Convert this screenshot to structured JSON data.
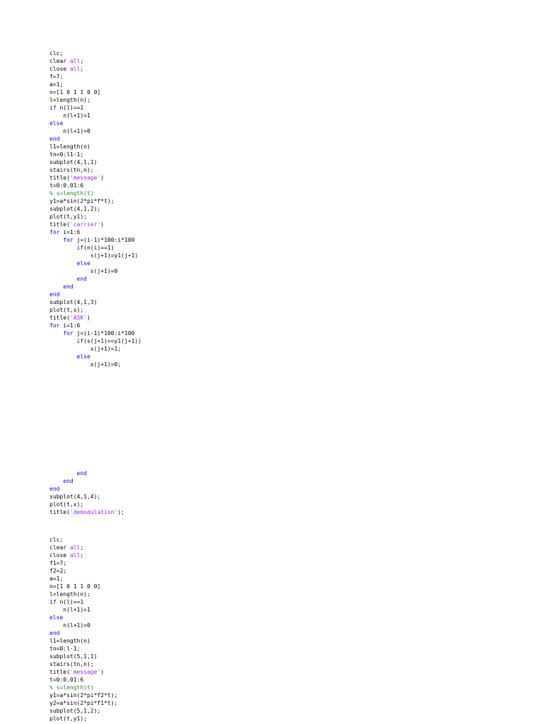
{
  "colors": {
    "plain": "#000000",
    "keyword": "#0000ff",
    "string": "#a020f0",
    "comment": "#228b22"
  },
  "document": {
    "blocks": [
      {
        "name": "ask-code-part-1",
        "lines": [
          [
            {
              "text": "clc;",
              "t": "plain"
            }
          ],
          [
            {
              "text": "clear ",
              "t": "plain"
            },
            {
              "text": "all",
              "t": "string"
            },
            {
              "text": ";",
              "t": "plain"
            }
          ],
          [
            {
              "text": "close ",
              "t": "plain"
            },
            {
              "text": "all",
              "t": "string"
            },
            {
              "text": ";",
              "t": "plain"
            }
          ],
          [
            {
              "text": "f=7;",
              "t": "plain"
            }
          ],
          [
            {
              "text": "a=1;",
              "t": "plain"
            }
          ],
          [
            {
              "text": "n=[1 0 1 1 0 0]",
              "t": "plain"
            }
          ],
          [
            {
              "text": "l=length(n);",
              "t": "plain"
            }
          ],
          [
            {
              "text": "if",
              "t": "keyword"
            },
            {
              "text": " n(l)==1",
              "t": "plain"
            }
          ],
          [
            {
              "text": "    n(l+1)=1",
              "t": "plain"
            }
          ],
          [
            {
              "text": "else",
              "t": "keyword"
            }
          ],
          [
            {
              "text": "    n(l+1)=0",
              "t": "plain"
            }
          ],
          [
            {
              "text": "end",
              "t": "keyword"
            }
          ],
          [
            {
              "text": "l1=length(n)",
              "t": "plain"
            }
          ],
          [
            {
              "text": "tn=0:l1-1;",
              "t": "plain"
            }
          ],
          [
            {
              "text": "subplot(4,1,1)",
              "t": "plain"
            }
          ],
          [
            {
              "text": "stairs(tn,n);",
              "t": "plain"
            }
          ],
          [
            {
              "text": "title(",
              "t": "plain"
            },
            {
              "text": "'message'",
              "t": "string"
            },
            {
              "text": ")",
              "t": "plain"
            }
          ],
          [
            {
              "text": "t=0:0.01:6",
              "t": "plain"
            }
          ],
          [
            {
              "text": "% s=length(t)",
              "t": "comment"
            }
          ],
          [
            {
              "text": "y1=a*sin(2*pi*f*t);",
              "t": "plain"
            }
          ],
          [
            {
              "text": "subplot(4,1,2);",
              "t": "plain"
            }
          ],
          [
            {
              "text": "plot(t,y1);",
              "t": "plain"
            }
          ],
          [
            {
              "text": "title(",
              "t": "plain"
            },
            {
              "text": "'carrier'",
              "t": "string"
            },
            {
              "text": ")",
              "t": "plain"
            }
          ],
          [
            {
              "text": "for",
              "t": "keyword"
            },
            {
              "text": " i=1:6",
              "t": "plain"
            }
          ],
          [
            {
              "text": "    ",
              "t": "plain"
            },
            {
              "text": "for",
              "t": "keyword"
            },
            {
              "text": " j=(i-1)*100:i*100",
              "t": "plain"
            }
          ],
          [
            {
              "text": "        ",
              "t": "plain"
            },
            {
              "text": "if",
              "t": "keyword"
            },
            {
              "text": "(n(i)==1)",
              "t": "plain"
            }
          ],
          [
            {
              "text": "            s(j+1)=y1(j+1)",
              "t": "plain"
            }
          ],
          [
            {
              "text": "        ",
              "t": "plain"
            },
            {
              "text": "else",
              "t": "keyword"
            }
          ],
          [
            {
              "text": "            s(j+1)=0",
              "t": "plain"
            }
          ],
          [
            {
              "text": "        ",
              "t": "plain"
            },
            {
              "text": "end",
              "t": "keyword"
            }
          ],
          [
            {
              "text": "    ",
              "t": "plain"
            },
            {
              "text": "end",
              "t": "keyword"
            }
          ],
          [
            {
              "text": "end",
              "t": "keyword"
            }
          ],
          [
            {
              "text": "subplot(4,1,3)",
              "t": "plain"
            }
          ],
          [
            {
              "text": "plot(t,s);",
              "t": "plain"
            }
          ],
          [
            {
              "text": "title(",
              "t": "plain"
            },
            {
              "text": "'ASK'",
              "t": "string"
            },
            {
              "text": ")",
              "t": "plain"
            }
          ],
          [
            {
              "text": "for",
              "t": "keyword"
            },
            {
              "text": " i=1:6",
              "t": "plain"
            }
          ],
          [
            {
              "text": "    ",
              "t": "plain"
            },
            {
              "text": "for",
              "t": "keyword"
            },
            {
              "text": " j=(i-1)*100:i*100",
              "t": "plain"
            }
          ],
          [
            {
              "text": "        ",
              "t": "plain"
            },
            {
              "text": "if",
              "t": "keyword"
            },
            {
              "text": "(s(j+1)==y1(j+1))",
              "t": "plain"
            }
          ],
          [
            {
              "text": "            x(j+1)=1;",
              "t": "plain"
            }
          ],
          [
            {
              "text": "        ",
              "t": "plain"
            },
            {
              "text": "else",
              "t": "keyword"
            }
          ],
          [
            {
              "text": "            x(j+1)=0;",
              "t": "plain"
            }
          ]
        ]
      },
      {
        "name": "ask-code-part-2",
        "lines": [
          [
            {
              "text": "        ",
              "t": "plain"
            },
            {
              "text": "end",
              "t": "keyword"
            }
          ],
          [
            {
              "text": "    ",
              "t": "plain"
            },
            {
              "text": "end",
              "t": "keyword"
            }
          ],
          [
            {
              "text": "end",
              "t": "keyword"
            }
          ],
          [
            {
              "text": "subplot(4,1,4);",
              "t": "plain"
            }
          ],
          [
            {
              "text": "plot(t,x);",
              "t": "plain"
            }
          ],
          [
            {
              "text": "title(",
              "t": "plain"
            },
            {
              "text": "'demodulation'",
              "t": "string"
            },
            {
              "text": ");",
              "t": "plain"
            }
          ]
        ]
      },
      {
        "name": "fsk-code",
        "lines": [
          [
            {
              "text": "clc;",
              "t": "plain"
            }
          ],
          [
            {
              "text": "clear ",
              "t": "plain"
            },
            {
              "text": "all",
              "t": "string"
            },
            {
              "text": ";",
              "t": "plain"
            }
          ],
          [
            {
              "text": "close ",
              "t": "plain"
            },
            {
              "text": "all",
              "t": "string"
            },
            {
              "text": ";",
              "t": "plain"
            }
          ],
          [
            {
              "text": "f1=7;",
              "t": "plain"
            }
          ],
          [
            {
              "text": "f2=2;",
              "t": "plain"
            }
          ],
          [
            {
              "text": "a=1;",
              "t": "plain"
            }
          ],
          [
            {
              "text": "n=[1 0 1 1 0 0]",
              "t": "plain"
            }
          ],
          [
            {
              "text": "l=length(n);",
              "t": "plain"
            }
          ],
          [
            {
              "text": "if",
              "t": "keyword"
            },
            {
              "text": " n(l)==1",
              "t": "plain"
            }
          ],
          [
            {
              "text": "    n(l+1)=1",
              "t": "plain"
            }
          ],
          [
            {
              "text": "else",
              "t": "keyword"
            }
          ],
          [
            {
              "text": "    n(l+1)=0",
              "t": "plain"
            }
          ],
          [
            {
              "text": "end",
              "t": "keyword"
            }
          ],
          [
            {
              "text": "l1=length(n)",
              "t": "plain"
            }
          ],
          [
            {
              "text": "tn=0:l-1;",
              "t": "plain"
            }
          ],
          [
            {
              "text": "subplot(5,1,1)",
              "t": "plain"
            }
          ],
          [
            {
              "text": "stairs(tn,n);",
              "t": "plain"
            }
          ],
          [
            {
              "text": "title(",
              "t": "plain"
            },
            {
              "text": "'message'",
              "t": "string"
            },
            {
              "text": ")",
              "t": "plain"
            }
          ],
          [
            {
              "text": "t=0:0.01:6",
              "t": "plain"
            }
          ],
          [
            {
              "text": "% s=length(t)",
              "t": "comment"
            }
          ],
          [
            {
              "text": "y1=a*sin(2*pi*f2*t);",
              "t": "plain"
            }
          ],
          [
            {
              "text": "y2=a*sin(2*pi*f1*t);",
              "t": "plain"
            }
          ],
          [
            {
              "text": "subplot(5,1,2);",
              "t": "plain"
            }
          ],
          [
            {
              "text": "plot(t,y1);",
              "t": "plain"
            }
          ]
        ]
      }
    ]
  }
}
